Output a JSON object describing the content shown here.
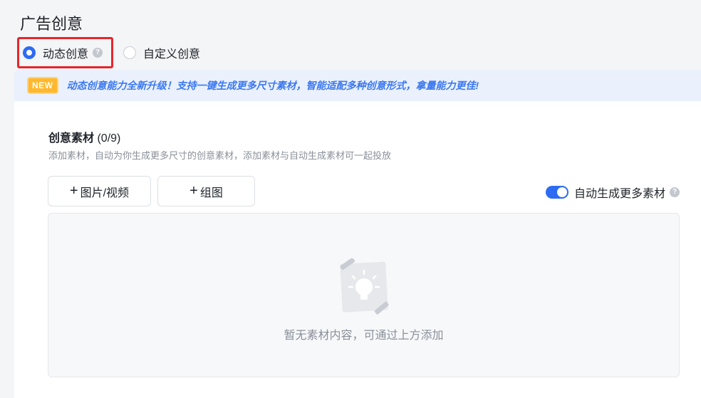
{
  "section": {
    "title": "广告创意"
  },
  "creative_type": {
    "options": [
      {
        "label": "动态创意",
        "selected": true,
        "help_icon": "question-icon"
      },
      {
        "label": "自定义创意",
        "selected": false
      }
    ]
  },
  "banner": {
    "badge": "NEW",
    "text": "动态创意能力全新升级！支持一键生成更多尺寸素材，智能适配多种创意形式，拿量能力更佳!"
  },
  "materials": {
    "title": "创意素材",
    "count": "(0/9)",
    "description": "添加素材，自动为你生成更多尺寸的创意素材，添加素材与自动生成素材可一起投放",
    "buttons": {
      "media": {
        "icon": "plus-icon",
        "label": "图片/视频"
      },
      "group": {
        "icon": "plus-icon",
        "label": "组图"
      }
    },
    "auto_generate": {
      "label": "自动生成更多素材",
      "enabled": true,
      "help_icon": "question-icon"
    },
    "empty": {
      "icon": "lightbulb-icon",
      "text": "暂无素材内容，可通过上方添加"
    }
  },
  "colors": {
    "accent": "#2d6bf2",
    "highlight_border": "#e6262b",
    "badge": "#ffb82e",
    "banner_text": "#3c78f0"
  }
}
